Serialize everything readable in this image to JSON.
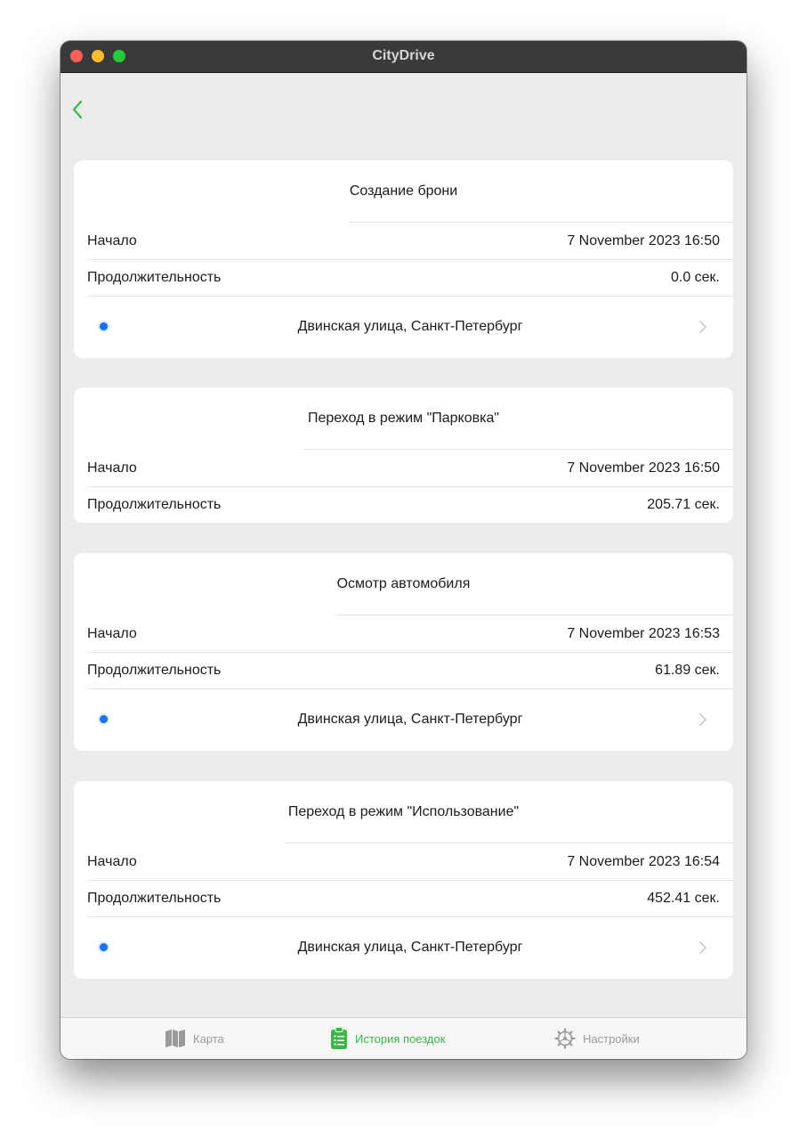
{
  "window": {
    "title": "CityDrive"
  },
  "colors": {
    "accent": "#3cb64a",
    "location_dot": "#1a73e8"
  },
  "events": [
    {
      "title": "Создание брони",
      "start_label": "Начало",
      "start_value": "7 November 2023  16:50",
      "duration_label": "Продолжительность",
      "duration_value": "0.0 сек.",
      "address": "Двинская улица, Санкт-Петербург"
    },
    {
      "title": "Переход в режим \"Парковка\"",
      "start_label": "Начало",
      "start_value": "7 November 2023  16:50",
      "duration_label": "Продолжительность",
      "duration_value": "205.71 сек."
    },
    {
      "title": "Осмотр автомобиля",
      "start_label": "Начало",
      "start_value": "7 November 2023  16:53",
      "duration_label": "Продолжительность",
      "duration_value": "61.89 сек.",
      "address": "Двинская улица, Санкт-Петербург"
    },
    {
      "title": "Переход в режим \"Использование\"",
      "start_label": "Начало",
      "start_value": "7 November 2023  16:54",
      "duration_label": "Продолжительность",
      "duration_value": "452.41 сек.",
      "address": "Двинская улица, Санкт-Петербург"
    }
  ],
  "tabbar": {
    "items": [
      {
        "label": "Карта",
        "icon": "map-icon",
        "active": false
      },
      {
        "label": "История поездок",
        "icon": "clipboard-list-icon",
        "active": true
      },
      {
        "label": "Настройки",
        "icon": "gear-icon",
        "active": false
      }
    ]
  }
}
